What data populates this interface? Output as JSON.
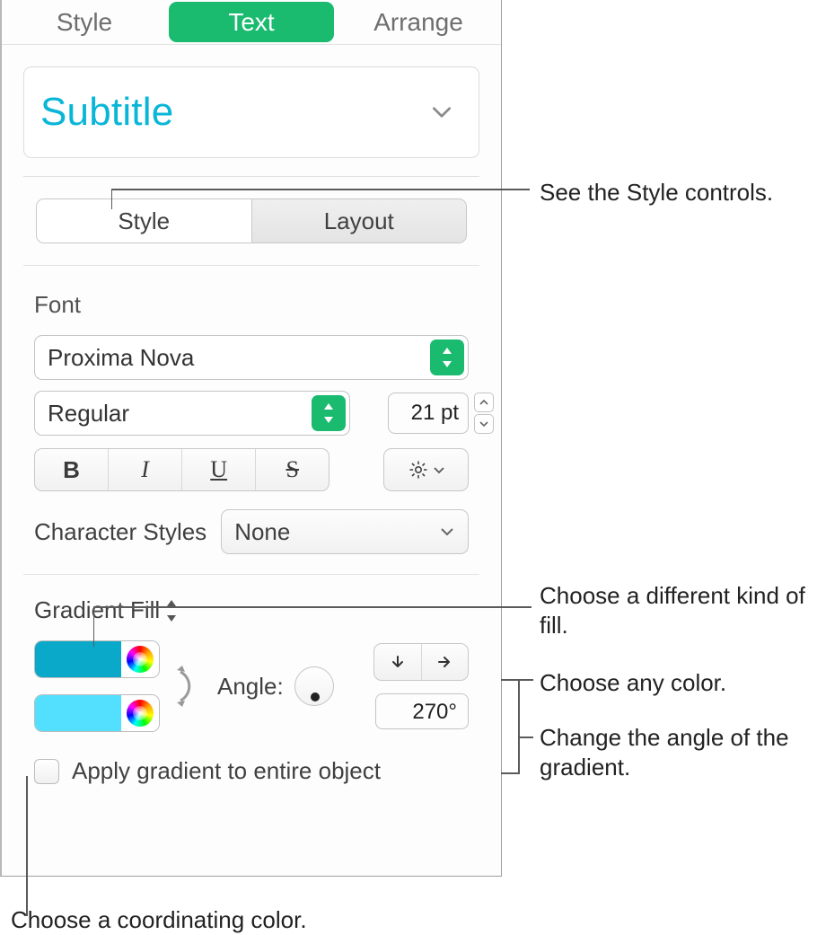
{
  "tabs": {
    "style": "Style",
    "text": "Text",
    "arrange": "Arrange",
    "active": "text"
  },
  "paragraphStyle": "Subtitle",
  "seg": {
    "style": "Style",
    "layout": "Layout"
  },
  "font": {
    "section": "Font",
    "family": "Proxima Nova",
    "weight": "Regular",
    "size": "21 pt",
    "charStylesLabel": "Character Styles",
    "charStylesValue": "None"
  },
  "fill": {
    "type": "Gradient Fill",
    "color1": "#0aa9c9",
    "color2": "#53e0ff",
    "angleLabel": "Angle:",
    "angleValue": "270°",
    "applyLabel": "Apply gradient to entire object"
  },
  "callouts": {
    "styleControls": "See the Style controls.",
    "fillKind": "Choose a different kind of fill.",
    "anyColor": "Choose any color.",
    "angle": "Change the angle of the gradient.",
    "coordColor": "Choose a coordinating color."
  }
}
